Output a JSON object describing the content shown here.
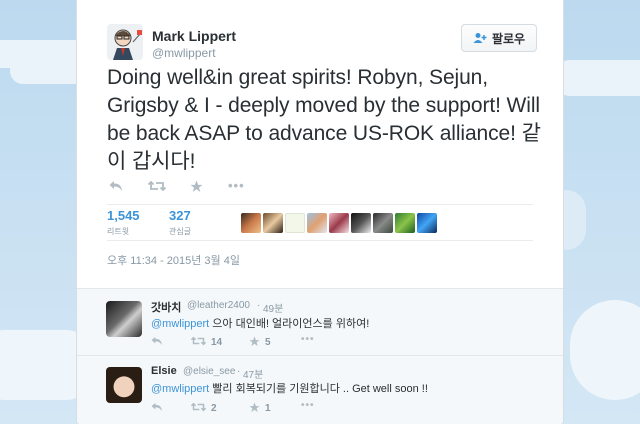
{
  "tweet": {
    "name": "Mark Lippert",
    "handle": "@mwlippert",
    "follow_label": "팔로우",
    "text": "Doing well&in great spirits! Robyn, Sejun, Grigsby & I - deeply moved by the support! Will be back ASAP to advance US-ROK alliance! 같이 갑시다!",
    "retweets": {
      "count": "1,545",
      "label": "리트윗"
    },
    "favorites": {
      "count": "327",
      "label": "관심글"
    },
    "timestamp": "오후 11:34 - 2015년 3월 4일",
    "icons": [
      "reply-icon",
      "retweet-icon",
      "favorite-icon",
      "more-icon",
      "follow-person-icon"
    ]
  },
  "replies": [
    {
      "name": "갓바치",
      "handle": "@leather2400",
      "time": "49분",
      "mention": "@mwlippert",
      "text": " 으아 대인배! 얼라이언스를 위하여!",
      "retweets": "14",
      "favorites": "5"
    },
    {
      "name": "Elsie",
      "handle": "@elsie_see",
      "time": "47분",
      "mention": "@mwlippert",
      "text": " 빨리 회복되기를 기원합니다 .. Get well soon !!",
      "retweets": "2",
      "favorites": "1"
    }
  ],
  "colors": {
    "link": "#3b94d9",
    "text": "#292f33",
    "muted": "#8899a6",
    "background": "#c6def0"
  }
}
